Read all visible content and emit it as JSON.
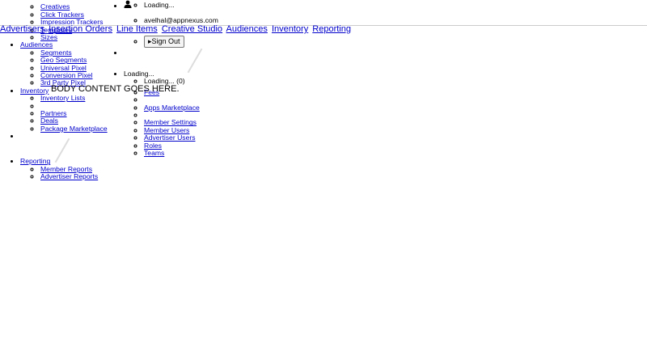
{
  "left_menu": {
    "creative_items": [
      "Creatives",
      "Click Trackers",
      "Impression Trackers",
      "Templates",
      "Sizes"
    ],
    "audiences": {
      "label": "Audiences",
      "items": [
        "Segments",
        "Geo Segments",
        "Universal Pixel",
        "Conversion Pixel",
        "3rd Party Pixel"
      ]
    },
    "inventory": {
      "label": "Inventory",
      "items": [
        "Inventory Lists",
        "",
        "Partners",
        "Deals",
        "Package Marketplace"
      ]
    },
    "reporting": {
      "label": "Reporting",
      "items": [
        "Member Reports",
        "Advertiser Reports"
      ]
    }
  },
  "top_nav": {
    "items": [
      "Advertisers",
      "Insertion Orders",
      "Line Items",
      "Creative Studio",
      "Audiences",
      "Inventory",
      "Reporting"
    ]
  },
  "user_menu": {
    "loading_top": "Loading...",
    "email": "avelhal@appnexus.com",
    "sign_out_label": "Sign Out",
    "loading_mid": "Loading...",
    "loading_count": "Loading... (0)",
    "admin_items": [
      "Fees",
      "",
      "Apps Marketplace",
      "",
      "Member Settings",
      "Member Users",
      "Advertiser Users",
      "Roles",
      "Teams"
    ]
  },
  "body_text": "BODY CONTENT GOES HERE."
}
